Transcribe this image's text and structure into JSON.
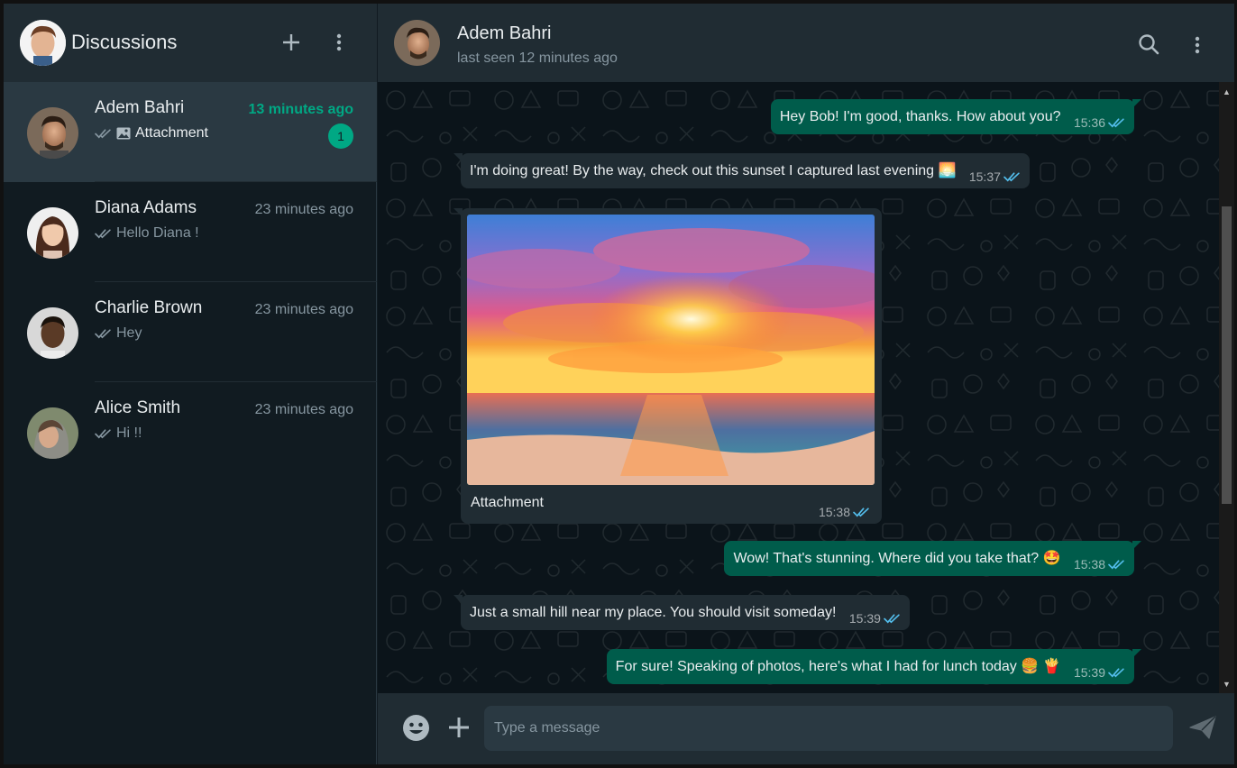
{
  "sidebar": {
    "title": "Discussions",
    "new_chat_icon": "plus-icon",
    "menu_icon": "vertical-dots-icon",
    "chats": [
      {
        "name": "Adem Bahri",
        "time": "13 minutes ago",
        "preview": "Attachment",
        "preview_icon": "image-icon",
        "unread": "1",
        "active": true
      },
      {
        "name": "Diana Adams",
        "time": "23 minutes ago",
        "preview": "Hello Diana !"
      },
      {
        "name": "Charlie Brown",
        "time": "23 minutes ago",
        "preview": "Hey"
      },
      {
        "name": "Alice Smith",
        "time": "23 minutes ago",
        "preview": "Hi !!"
      }
    ]
  },
  "conversation": {
    "name": "Adem Bahri",
    "status": "last seen 12 minutes ago",
    "search_icon": "search-icon",
    "menu_icon": "vertical-dots-icon",
    "messages": [
      {
        "direction": "out",
        "text": "Hey Bob! I'm good, thanks. How about you?",
        "time": "15:36"
      },
      {
        "direction": "in",
        "text": "I'm doing great! By the way, check out this sunset I captured last evening 🌅",
        "time": "15:37"
      },
      {
        "direction": "in",
        "type": "image",
        "caption": "Attachment",
        "time": "15:38"
      },
      {
        "direction": "out",
        "text": "Wow! That's stunning. Where did you take that? 🤩",
        "time": "15:38"
      },
      {
        "direction": "in",
        "text": "Just a small hill near my place. You should visit someday!",
        "time": "15:39"
      },
      {
        "direction": "out",
        "text": "For sure! Speaking of photos, here's what I had for lunch today 🍔 🍟",
        "time": "15:39"
      }
    ]
  },
  "composer": {
    "placeholder": "Type a message",
    "emoji_icon": "smiley-icon",
    "attach_icon": "plus-icon",
    "send_icon": "send-icon"
  },
  "colors": {
    "accent": "#00a884",
    "outgoing_bubble": "#005c4b",
    "incoming_bubble": "#202c33",
    "read_ticks": "#53bdeb"
  }
}
